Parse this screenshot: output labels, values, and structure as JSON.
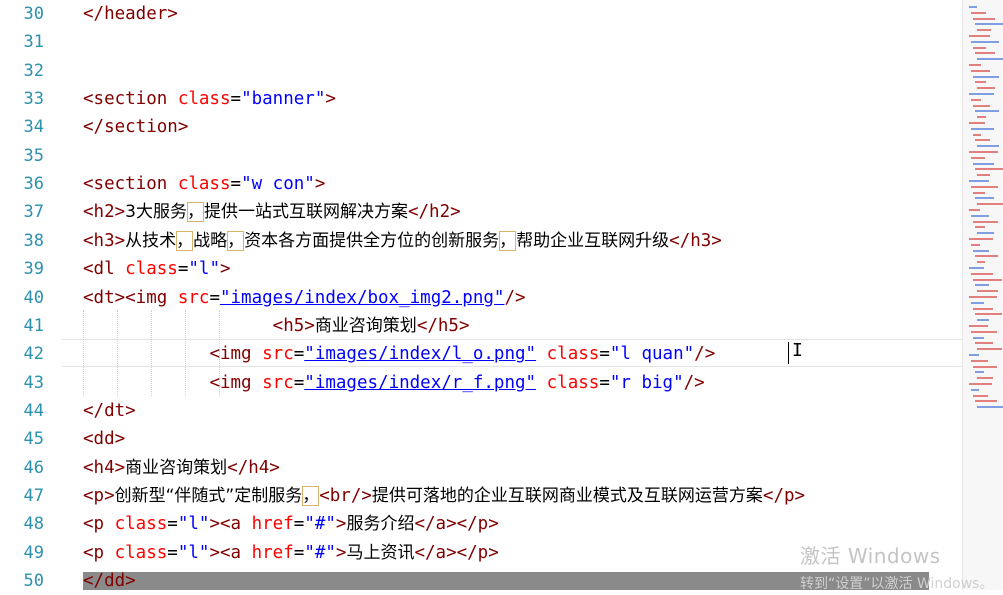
{
  "editor": {
    "lines": [
      {
        "num": "30",
        "parts": [
          [
            "t",
            "</header>"
          ]
        ]
      },
      {
        "num": "31",
        "parts": []
      },
      {
        "num": "32",
        "parts": []
      },
      {
        "num": "33",
        "parts": [
          [
            "t",
            "<section "
          ],
          [
            "a",
            "class"
          ],
          [
            "p",
            "="
          ],
          [
            "s",
            "\"banner\""
          ],
          [
            "t",
            ">"
          ]
        ]
      },
      {
        "num": "34",
        "parts": [
          [
            "t",
            "</section>"
          ]
        ]
      },
      {
        "num": "35",
        "parts": []
      },
      {
        "num": "36",
        "parts": [
          [
            "t",
            "<section "
          ],
          [
            "a",
            "class"
          ],
          [
            "p",
            "="
          ],
          [
            "s",
            "\"w con\""
          ],
          [
            "t",
            ">"
          ]
        ]
      },
      {
        "num": "37",
        "parts": [
          [
            "t",
            "<h2>"
          ],
          [
            "cn",
            "3大服务"
          ],
          [
            "bx",
            "，"
          ],
          [
            "cn",
            "提供一站式互联网解决方案"
          ],
          [
            "t",
            "</h2>"
          ]
        ]
      },
      {
        "num": "38",
        "parts": [
          [
            "t",
            "<h3>"
          ],
          [
            "cn",
            "从技术"
          ],
          [
            "bx",
            "，"
          ],
          [
            "cn",
            "战略"
          ],
          [
            "bx",
            "，"
          ],
          [
            "cn",
            "资本各方面提供全方位的创新服务"
          ],
          [
            "bx",
            "，"
          ],
          [
            "cn",
            "帮助企业互联网升级"
          ],
          [
            "t",
            "</h3>"
          ]
        ]
      },
      {
        "num": "39",
        "parts": [
          [
            "t",
            "<dl "
          ],
          [
            "a",
            "class"
          ],
          [
            "p",
            "="
          ],
          [
            "s",
            "\"l\""
          ],
          [
            "t",
            ">"
          ]
        ]
      },
      {
        "num": "40",
        "parts": [
          [
            "t",
            "<dt><img "
          ],
          [
            "a",
            "src"
          ],
          [
            "p",
            "="
          ],
          [
            "u",
            "\"images/index/box_img2.png\""
          ],
          [
            "t",
            "/>"
          ]
        ]
      },
      {
        "num": "41",
        "parts": [
          [
            "sp",
            "                  "
          ],
          [
            "t",
            "<h5>"
          ],
          [
            "cn",
            "商业咨询策划"
          ],
          [
            "t",
            "</h5>"
          ]
        ]
      },
      {
        "num": "42",
        "parts": [
          [
            "sp",
            "            "
          ],
          [
            "t",
            "<img "
          ],
          [
            "a",
            "src"
          ],
          [
            "p",
            "="
          ],
          [
            "u",
            "\"images/index/l_o.png\""
          ],
          [
            "p",
            " "
          ],
          [
            "a",
            "class"
          ],
          [
            "p",
            "="
          ],
          [
            "s",
            "\"l quan\""
          ],
          [
            "t",
            "/>"
          ]
        ]
      },
      {
        "num": "43",
        "parts": [
          [
            "sp",
            "            "
          ],
          [
            "t",
            "<img "
          ],
          [
            "a",
            "src"
          ],
          [
            "p",
            "="
          ],
          [
            "u",
            "\"images/index/r_f.png\""
          ],
          [
            "p",
            " "
          ],
          [
            "a",
            "class"
          ],
          [
            "p",
            "="
          ],
          [
            "s",
            "\"r big\""
          ],
          [
            "t",
            "/>"
          ]
        ]
      },
      {
        "num": "44",
        "parts": [
          [
            "t",
            "</dt>"
          ]
        ]
      },
      {
        "num": "45",
        "parts": [
          [
            "t",
            "<dd>"
          ]
        ]
      },
      {
        "num": "46",
        "parts": [
          [
            "t",
            "<h4>"
          ],
          [
            "cn",
            "商业咨询策划"
          ],
          [
            "t",
            "</h4>"
          ]
        ]
      },
      {
        "num": "47",
        "parts": [
          [
            "t",
            "<p>"
          ],
          [
            "cn",
            "创新型“伴随式”定制服务"
          ],
          [
            "bx",
            "，"
          ],
          [
            "t",
            "<br/>"
          ],
          [
            "cn",
            "提供可落地的企业互联网商业模式及互联网运营方案"
          ],
          [
            "t",
            "</p>"
          ]
        ]
      },
      {
        "num": "48",
        "parts": [
          [
            "t",
            "<p "
          ],
          [
            "a",
            "class"
          ],
          [
            "p",
            "="
          ],
          [
            "s",
            "\"l\""
          ],
          [
            "t",
            "><a "
          ],
          [
            "a",
            "href"
          ],
          [
            "p",
            "="
          ],
          [
            "s",
            "\"#\""
          ],
          [
            "t",
            ">"
          ],
          [
            "cn",
            "服务介绍"
          ],
          [
            "t",
            "</a></p>"
          ]
        ]
      },
      {
        "num": "49",
        "parts": [
          [
            "t",
            "<p "
          ],
          [
            "a",
            "class"
          ],
          [
            "p",
            "="
          ],
          [
            "s",
            "\"l\""
          ],
          [
            "t",
            "><a "
          ],
          [
            "a",
            "href"
          ],
          [
            "p",
            "="
          ],
          [
            "s",
            "\"#\""
          ],
          [
            "t",
            ">"
          ],
          [
            "cn",
            "马上资讯"
          ],
          [
            "t",
            "</a></p>"
          ]
        ]
      },
      {
        "num": "50",
        "parts": [
          [
            "t",
            "</dd>"
          ]
        ]
      }
    ]
  },
  "colors": {
    "tag": "#800000",
    "attr": "#ff0000",
    "string": "#0000ff",
    "line_number": "#2b91af"
  },
  "watermark": {
    "title": "激活 Windows",
    "subtitle": "转到“设置”以激活 Windows。"
  }
}
